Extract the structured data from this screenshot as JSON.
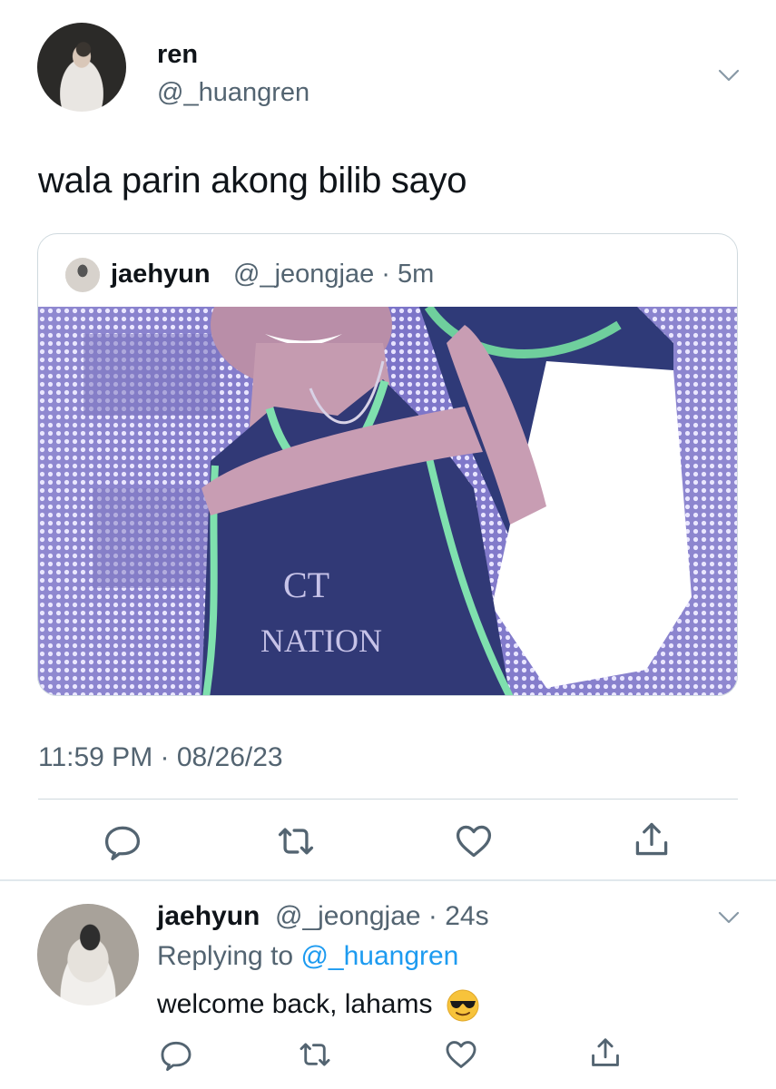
{
  "tweet": {
    "display_name": "ren",
    "handle": "@_huangren",
    "text": "wala parin akong bilib sayo",
    "timestamp": "11:59 PM · 08/26/23"
  },
  "quote": {
    "display_name": "jaehyun",
    "handle_time": "@_jeongjae · 5m",
    "image_text": {
      "line1": "CT",
      "line2": "NATION"
    }
  },
  "reply": {
    "display_name": "jaehyun",
    "handle_time": "@_jeongjae · 24s",
    "replying_prefix": "Replying to",
    "replying_handle": "@_huangren",
    "text": "welcome back, lahams",
    "emoji": "sunglasses-emoji"
  },
  "icons": {
    "reply": "reply-icon",
    "retweet": "retweet-icon",
    "like": "heart-icon",
    "share": "share-icon",
    "more": "chevron-down-icon"
  },
  "colors": {
    "text": "#0f1419",
    "secondary": "#536471",
    "link": "#1d9bf0",
    "border": "#cfd9de"
  }
}
